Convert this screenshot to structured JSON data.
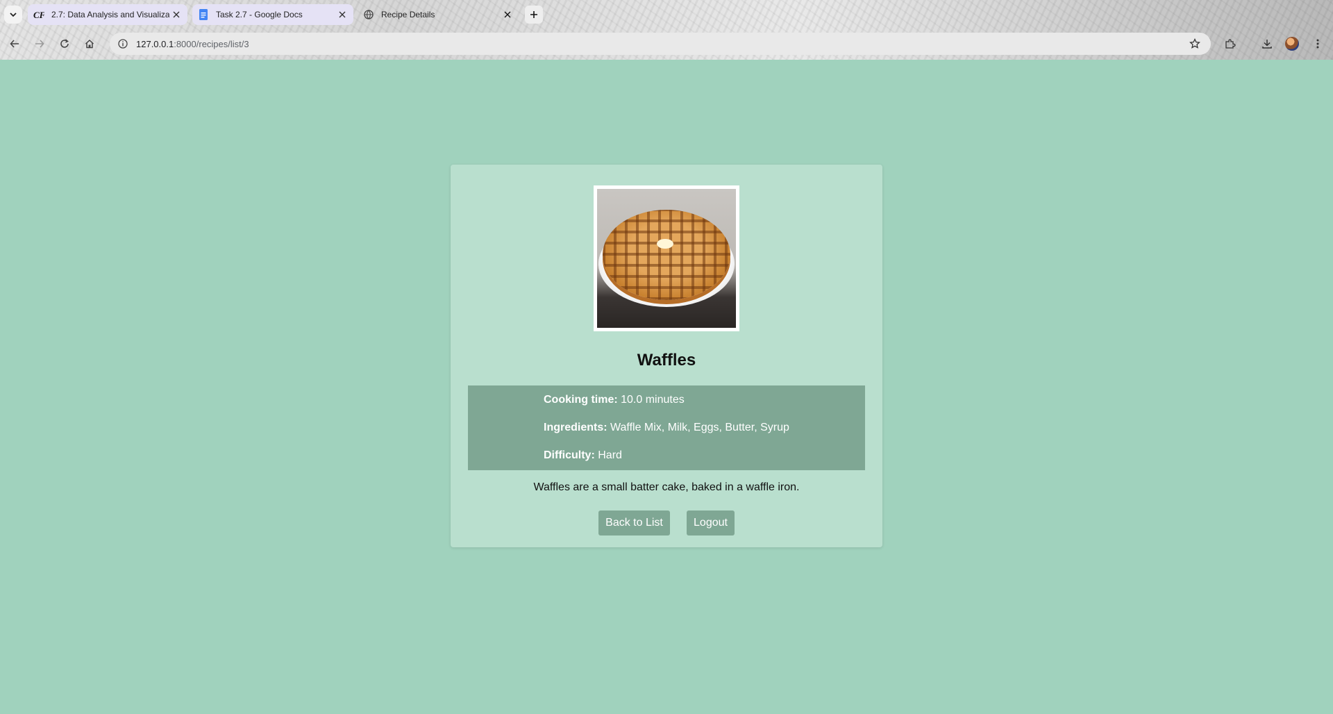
{
  "browser": {
    "tabs": [
      {
        "title": "2.7: Data Analysis and Visualiza",
        "favicon": "cf-logo-icon",
        "active": false
      },
      {
        "title": "Task 2.7 - Google Docs",
        "favicon": "google-docs-icon",
        "active": false
      },
      {
        "title": "Recipe Details",
        "favicon": "globe-icon",
        "active": true
      }
    ],
    "address": {
      "host": "127.0.0.1",
      "path": ":8000/recipes/list/3"
    }
  },
  "recipe": {
    "title": "Waffles",
    "image_alt": "waffle on plate",
    "details": [
      {
        "label": "Cooking time:",
        "value": "10.0 minutes"
      },
      {
        "label": "Ingredients:",
        "value": "Waffle Mix, Milk, Eggs, Butter, Syrup"
      },
      {
        "label": "Difficulty:",
        "value": "Hard"
      }
    ],
    "description": "Waffles are a small batter cake, baked in a waffle iron."
  },
  "actions": {
    "back_label": "Back to List",
    "logout_label": "Logout"
  },
  "colors": {
    "page_bg": "#a0d2bd",
    "card_bg": "#b9dfce",
    "accent": "#7fa794"
  }
}
